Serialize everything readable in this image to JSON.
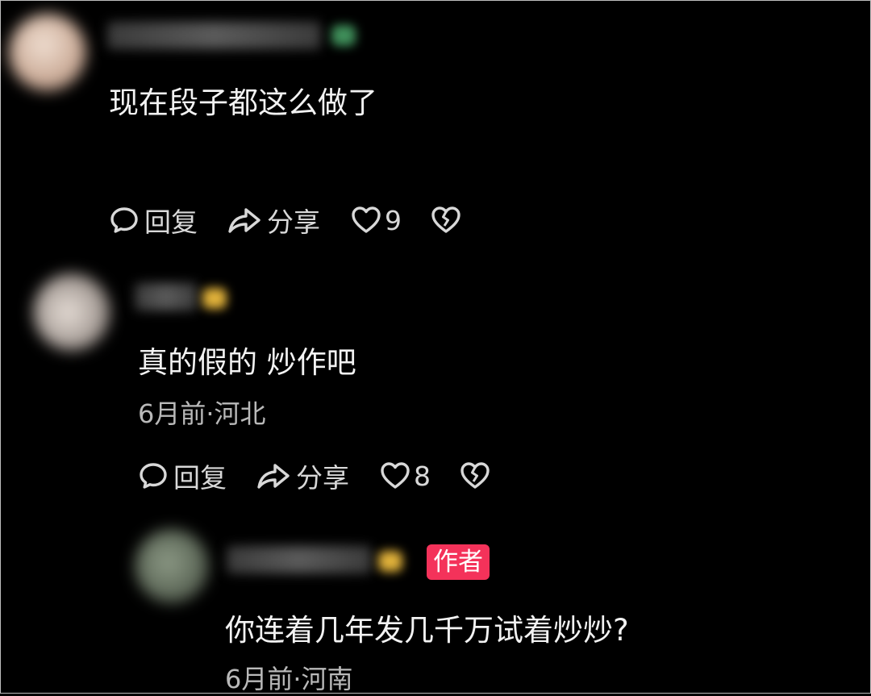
{
  "comments": [
    {
      "text": "现在段子都这么做了",
      "actions": {
        "reply": "回复",
        "share": "分享",
        "likes": "9"
      },
      "colors": {
        "avatar": "#d9c3b6",
        "mark": "#3f8f5a"
      }
    },
    {
      "text": "真的假的 炒作吧",
      "meta": "6月前·河北",
      "actions": {
        "reply": "回复",
        "share": "分享",
        "likes": "8"
      },
      "colors": {
        "avatar": "#a9a09a",
        "mark": "#e0b13a"
      }
    },
    {
      "badge": "作者",
      "text": "你连着几年发几千万试着炒炒?",
      "meta": "6月前·河南",
      "colors": {
        "avatar": "#5f6a5a",
        "mark": "#e0b13a",
        "badge": "#f4325a"
      }
    }
  ],
  "icons": [
    "comment-icon",
    "share-icon",
    "heart-icon",
    "broken-heart-icon"
  ]
}
